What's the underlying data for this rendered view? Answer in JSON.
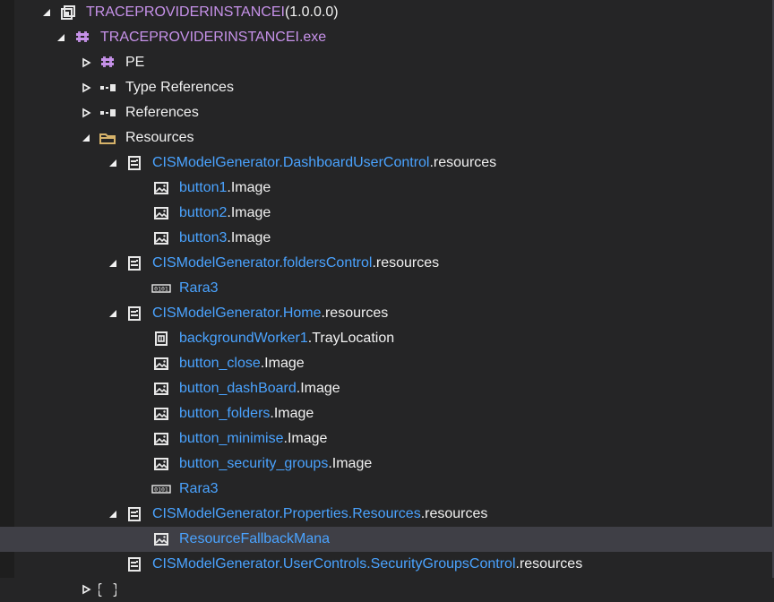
{
  "tree": {
    "rows": [
      {
        "level": 0,
        "expander": "expanded",
        "icon": "assembly-icon",
        "parts": [
          {
            "text": "TRACEPROVIDERINSTANCEI",
            "tone": "purple"
          },
          {
            "text": " (1.0.0.0)",
            "tone": "white"
          }
        ]
      },
      {
        "level": 1,
        "expander": "expanded",
        "icon": "module-icon",
        "parts": [
          {
            "text": "TRACEPROVIDERINSTANCEI.exe",
            "tone": "purple"
          }
        ]
      },
      {
        "level": 2,
        "expander": "collapsed",
        "icon": "module-icon",
        "parts": [
          {
            "text": "PE",
            "tone": "white"
          }
        ]
      },
      {
        "level": 2,
        "expander": "collapsed",
        "icon": "reference-icon",
        "parts": [
          {
            "text": "Type References",
            "tone": "white"
          }
        ]
      },
      {
        "level": 2,
        "expander": "collapsed",
        "icon": "reference-icon",
        "parts": [
          {
            "text": "References",
            "tone": "white"
          }
        ]
      },
      {
        "level": 2,
        "expander": "expanded",
        "icon": "folder-icon",
        "parts": [
          {
            "text": "Resources",
            "tone": "white"
          }
        ]
      },
      {
        "level": 3,
        "expander": "expanded",
        "icon": "resource-file-icon",
        "parts": [
          {
            "text": "CISModelGenerator.DashboardUserControl",
            "tone": "blue"
          },
          {
            "text": ".resources",
            "tone": "white"
          }
        ]
      },
      {
        "level": 4,
        "expander": "none",
        "icon": "image-icon",
        "parts": [
          {
            "text": "button1",
            "tone": "blue"
          },
          {
            "text": ".Image",
            "tone": "white"
          }
        ]
      },
      {
        "level": 4,
        "expander": "none",
        "icon": "image-icon",
        "parts": [
          {
            "text": "button2",
            "tone": "blue"
          },
          {
            "text": ".Image",
            "tone": "white"
          }
        ]
      },
      {
        "level": 4,
        "expander": "none",
        "icon": "image-icon",
        "parts": [
          {
            "text": "button3",
            "tone": "blue"
          },
          {
            "text": ".Image",
            "tone": "white"
          }
        ]
      },
      {
        "level": 3,
        "expander": "expanded",
        "icon": "resource-file-icon",
        "parts": [
          {
            "text": "CISModelGenerator.foldersControl",
            "tone": "blue"
          },
          {
            "text": ".resources",
            "tone": "white"
          }
        ]
      },
      {
        "level": 4,
        "expander": "none",
        "icon": "binary-icon",
        "parts": [
          {
            "text": "Rara3",
            "tone": "blue"
          }
        ]
      },
      {
        "level": 3,
        "expander": "expanded",
        "icon": "resource-file-icon",
        "parts": [
          {
            "text": "CISModelGenerator.Home",
            "tone": "blue"
          },
          {
            "text": ".resources",
            "tone": "white"
          }
        ]
      },
      {
        "level": 4,
        "expander": "none",
        "icon": "location-icon",
        "parts": [
          {
            "text": "backgroundWorker1",
            "tone": "blue"
          },
          {
            "text": ".TrayLocation",
            "tone": "white"
          }
        ]
      },
      {
        "level": 4,
        "expander": "none",
        "icon": "image-icon",
        "parts": [
          {
            "text": "button_close",
            "tone": "blue"
          },
          {
            "text": ".Image",
            "tone": "white"
          }
        ]
      },
      {
        "level": 4,
        "expander": "none",
        "icon": "image-icon",
        "parts": [
          {
            "text": "button_dashBoard",
            "tone": "blue"
          },
          {
            "text": ".Image",
            "tone": "white"
          }
        ]
      },
      {
        "level": 4,
        "expander": "none",
        "icon": "image-icon",
        "parts": [
          {
            "text": "button_folders",
            "tone": "blue"
          },
          {
            "text": ".Image",
            "tone": "white"
          }
        ]
      },
      {
        "level": 4,
        "expander": "none",
        "icon": "image-icon",
        "parts": [
          {
            "text": "button_minimise",
            "tone": "blue"
          },
          {
            "text": ".Image",
            "tone": "white"
          }
        ]
      },
      {
        "level": 4,
        "expander": "none",
        "icon": "image-icon",
        "parts": [
          {
            "text": "button_security_groups",
            "tone": "blue"
          },
          {
            "text": ".Image",
            "tone": "white"
          }
        ]
      },
      {
        "level": 4,
        "expander": "none",
        "icon": "binary-icon",
        "parts": [
          {
            "text": "Rara3",
            "tone": "blue"
          }
        ]
      },
      {
        "level": 3,
        "expander": "expanded",
        "icon": "resource-file-icon",
        "parts": [
          {
            "text": "CISModelGenerator.Properties.Resources",
            "tone": "blue"
          },
          {
            "text": ".resources",
            "tone": "white"
          }
        ]
      },
      {
        "level": 4,
        "expander": "none",
        "icon": "image-icon",
        "selected": true,
        "parts": [
          {
            "text": "ResourceFallbackMana",
            "tone": "blue"
          }
        ]
      },
      {
        "level": 3,
        "expander": "none",
        "icon": "resource-file-icon",
        "parts": [
          {
            "text": "CISModelGenerator.UserControls.SecurityGroupsControl",
            "tone": "blue"
          },
          {
            "text": ".resources",
            "tone": "white"
          }
        ]
      },
      {
        "level": 2,
        "expander": "collapsed",
        "icon": "braces-icon",
        "parts": [
          {
            "text": "",
            "tone": "white"
          }
        ]
      }
    ]
  }
}
